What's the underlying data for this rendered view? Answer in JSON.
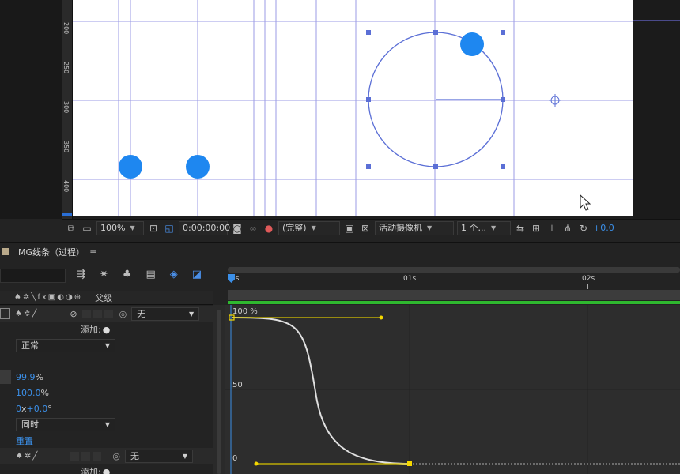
{
  "viewer": {
    "zoom": "100%",
    "timecode": "0:00:00:00",
    "resolution": "(完整)",
    "camera": "活动摄像机",
    "views": "1 个...",
    "exposure": "+0.0",
    "ruler_labels": [
      "200",
      "250",
      "300",
      "350",
      "400"
    ]
  },
  "panel": {
    "comp_name": "MG线条（过程）",
    "menu_icon": "hamburger-menu-icon"
  },
  "layer_columns": {
    "parent_label": "父级"
  },
  "layers": {
    "layer1": {
      "parent_value": "无",
      "add_label": "添加:",
      "blend_mode": "正常",
      "scale_pct": "99.9",
      "scale_unit": "%",
      "opacity_pct": "100.0",
      "opacity_unit": "%",
      "rotation_turns": "0",
      "rotation_x": "x",
      "rotation_deg": "+0.0",
      "rotation_unit": "°",
      "timing": "同时",
      "reset": "重置"
    },
    "layer2": {
      "parent_value": "无",
      "add_label": "添加:"
    }
  },
  "timeline": {
    "ticks": [
      "0s",
      "01s",
      "02s"
    ],
    "graph_labels": [
      "100 %",
      "50",
      "0"
    ]
  },
  "colors": {
    "accent_blue": "#1e87f0",
    "guide_line": "#8a8ae0",
    "path_stroke": "#5b6fd6",
    "keyframe_yellow": "#f5d800",
    "work_area_green": "#2fb82f"
  }
}
